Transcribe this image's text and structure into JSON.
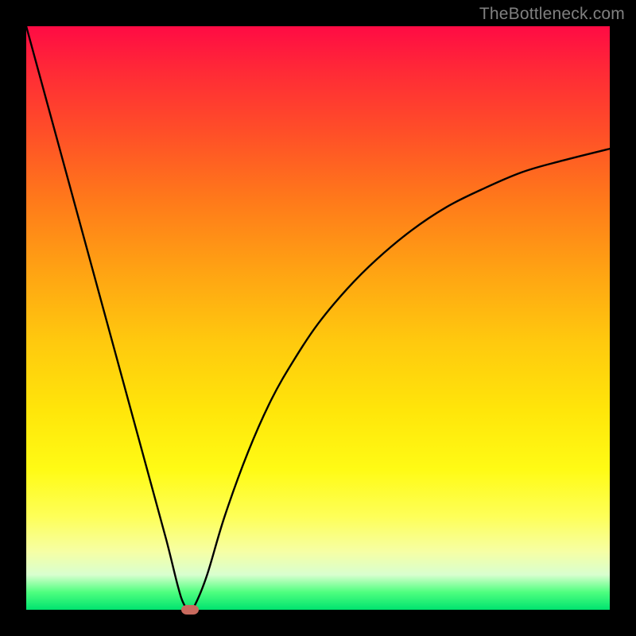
{
  "watermark": "TheBottleneck.com",
  "chart_data": {
    "type": "line",
    "title": "",
    "xlabel": "",
    "ylabel": "",
    "xlim": [
      0,
      100
    ],
    "ylim": [
      0,
      100
    ],
    "series": [
      {
        "name": "curve",
        "x": [
          0,
          3,
          6,
          9,
          12,
          15,
          18,
          21,
          24,
          26,
          27,
          28,
          29,
          31,
          34,
          38,
          42,
          46,
          50,
          55,
          60,
          66,
          72,
          78,
          85,
          92,
          100
        ],
        "values": [
          100,
          89,
          78,
          67,
          56,
          45,
          34,
          23,
          12,
          4,
          1,
          0,
          1,
          6,
          16,
          27,
          36,
          43,
          49,
          55,
          60,
          65,
          69,
          72,
          75,
          77,
          79
        ]
      }
    ],
    "min_marker": {
      "x": 28,
      "y": 0
    },
    "gradient_stops": [
      {
        "pct": 0,
        "color": "#ff0b44"
      },
      {
        "pct": 18,
        "color": "#ff4e28"
      },
      {
        "pct": 42,
        "color": "#ffa313"
      },
      {
        "pct": 66,
        "color": "#ffe60a"
      },
      {
        "pct": 90,
        "color": "#f6ffa4"
      },
      {
        "pct": 100,
        "color": "#00e36f"
      }
    ]
  }
}
